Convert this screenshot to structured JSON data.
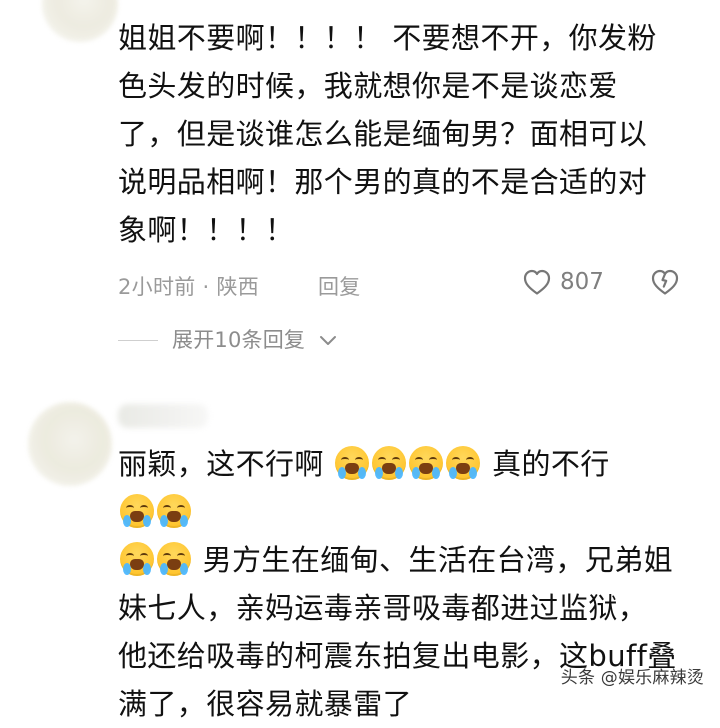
{
  "comments": [
    {
      "text_line1": "姐姐不要啊！！！！ 不要想不开，你发粉",
      "text_line2": "色头发的时候，我就想你是不是谈恋爱",
      "text_line3": "了，但是谈谁怎么能是缅甸男？面相可以",
      "text_line4": "说明品相啊！那个男的真的不是合适的对",
      "text_line5": "象啊！！！！",
      "meta": "2小时前 · 陕西",
      "reply_label": "回复",
      "likes": "807",
      "expand_replies": "展开10条回复"
    },
    {
      "segment_1": "丽颖，这不行啊",
      "segment_2": "真的不行",
      "segment_3": "男方生在缅甸、生活在台湾，兄弟姐",
      "segment_4": "妹七人，亲妈运毒亲哥吸毒都进过监狱，",
      "segment_5": "他还给吸毒的柯震东拍复出电影，这buff叠",
      "segment_6": "满了，很容易就暴雷了"
    }
  ],
  "watermark": "头条 @娱乐麻辣烫",
  "icons": {
    "heart": "heart-outline-icon",
    "dislike": "broken-heart-icon",
    "expand": "chevron-down-icon",
    "emoji": "crying-face-icon"
  }
}
